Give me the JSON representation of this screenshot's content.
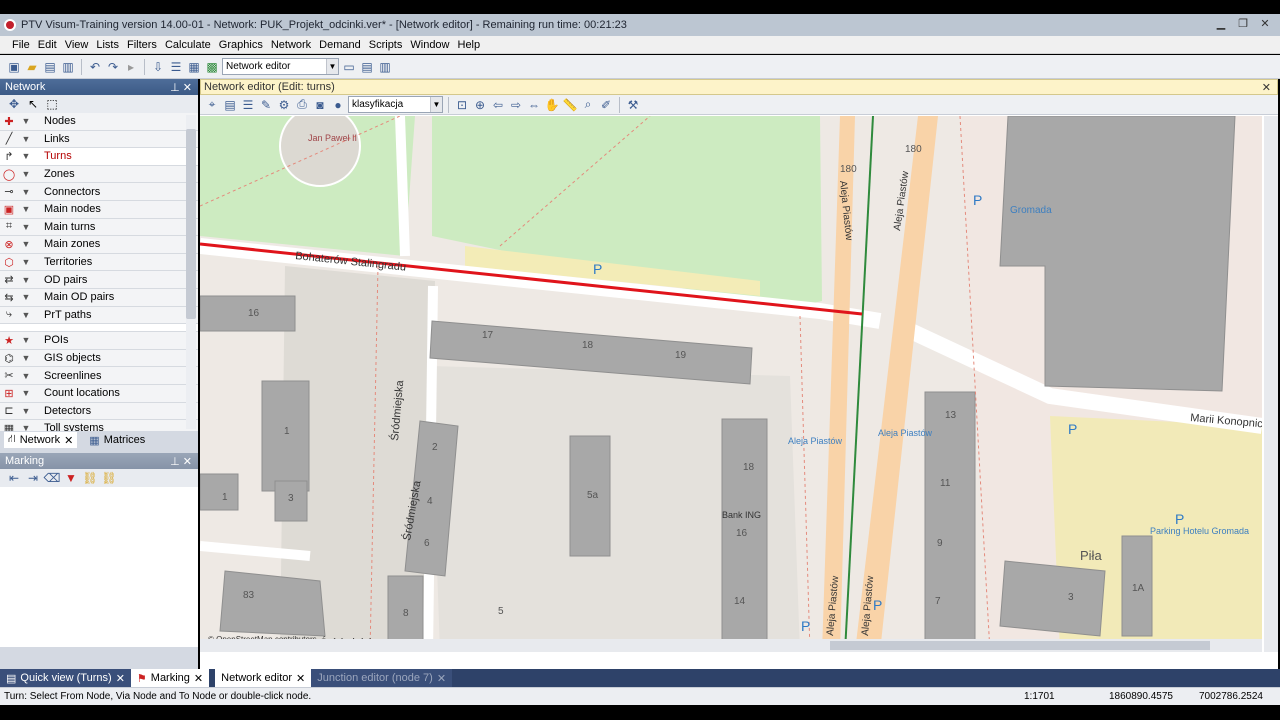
{
  "window": {
    "title": "PTV Visum-Training version 14.00-01 - Network: PUK_Projekt_odcinki.ver* - [Network editor] - Remaining run time: 00:21:23"
  },
  "menu": [
    "File",
    "Edit",
    "View",
    "Lists",
    "Filters",
    "Calculate",
    "Graphics",
    "Network",
    "Demand",
    "Scripts",
    "Window",
    "Help"
  ],
  "toolbar": {
    "view_select": "Network editor"
  },
  "network_panel": {
    "title": "Network",
    "layers": [
      "Nodes",
      "Links",
      "Turns",
      "Zones",
      "Connectors",
      "Main nodes",
      "Main turns",
      "Main zones",
      "Territories",
      "OD pairs",
      "Main OD pairs",
      "PrT paths",
      "POIs",
      "GIS objects",
      "Screenlines",
      "Count locations",
      "Detectors",
      "Toll systems"
    ],
    "selected": "Turns",
    "tabs": [
      "Network",
      "Matrices"
    ]
  },
  "marking_panel": {
    "title": "Marking"
  },
  "editor": {
    "title": "Network editor (Edit: turns)",
    "classification": "klasyfikacja",
    "map_labels": {
      "jan_pawel": "Jan Paweł II",
      "street_bohaterow": "Bohaterów Stalingradu",
      "street_srodmiejska_1": "Śródmiejska",
      "street_srodmiejska_2": "Śródmiejska",
      "street_srodmiejska_3": "Śródmiejska",
      "aleja_1": "Aleja Piastów",
      "aleja_2": "Aleja Piastów",
      "aleja_3": "Aleja Piastów",
      "aleja_4": "Aleja Piastów",
      "road_180a": "180",
      "road_180b": "180",
      "marii": "Marii Konopnickiej",
      "gromada": "Gromada",
      "bus1": "Aleja Piastów",
      "bus2": "Aleja Piastów",
      "bank": "Bank ING",
      "parking": "Parking Hotelu Gromada",
      "pila": "Piła",
      "osm": "© OpenStreetMap contributors",
      "parking_p": "P"
    },
    "buildings": [
      "16",
      "17",
      "18",
      "19",
      "1",
      "2",
      "3",
      "4",
      "5",
      "6",
      "8",
      "83",
      "5a",
      "18",
      "16",
      "14",
      "13",
      "11",
      "9",
      "7",
      "3",
      "1A",
      "1"
    ]
  },
  "bottom_tabs": [
    "Quick view (Turns)",
    "Marking",
    "Network editor",
    "Junction editor (node 7)"
  ],
  "status": {
    "hint": "Turn: Select From Node, Via Node and To Node or double-click node.",
    "scale": "1:1701",
    "x": "1860890.4575",
    "y": "7002786.2524"
  }
}
